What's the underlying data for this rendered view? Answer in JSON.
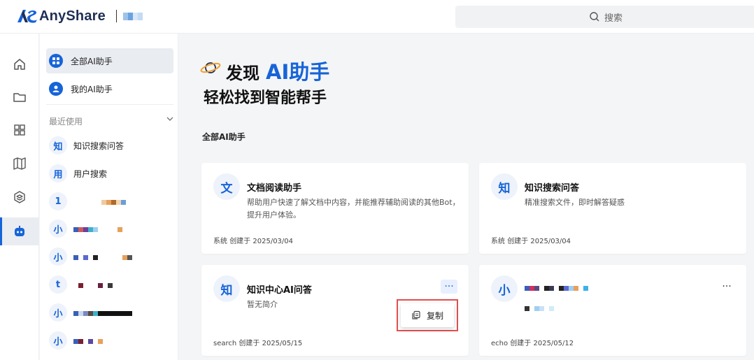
{
  "app": {
    "logo_text": "AnyShare"
  },
  "search": {
    "placeholder": "搜索"
  },
  "sidebar": {
    "nav": [
      {
        "label": "全部AI助手",
        "icon": "grid-icon",
        "active": true
      },
      {
        "label": "我的AI助手",
        "icon": "user-icon",
        "active": false
      }
    ],
    "recent_title": "最近使用",
    "recent": [
      {
        "avatar": "知",
        "label": "知识搜索问答"
      },
      {
        "avatar": "用",
        "label": "用户搜索"
      },
      {
        "avatar": "1",
        "label": ""
      },
      {
        "avatar": "小",
        "label": ""
      },
      {
        "avatar": "小",
        "label": ""
      },
      {
        "avatar": "t",
        "label": ""
      },
      {
        "avatar": "小",
        "label": ""
      },
      {
        "avatar": "小",
        "label": ""
      }
    ]
  },
  "rail": [
    "home-icon",
    "folder-icon",
    "apps-icon",
    "map-icon",
    "layers-icon",
    "bot-icon"
  ],
  "hero": {
    "title": "发现",
    "title_accent": "AI助手",
    "subtitle": "轻松找到智能帮手"
  },
  "section_title": "全部AI助手",
  "cards": [
    {
      "avatar": "文",
      "name": "文档阅读助手",
      "desc": "帮助用户快速了解文档中内容，并能推荐辅助阅读的其他Bot，提升用户体验。",
      "creator": "系统",
      "created_label": "创建于",
      "date": "2025/03/04"
    },
    {
      "avatar": "知",
      "name": "知识搜索问答",
      "desc": "精准搜索文件，即时解答疑惑",
      "creator": "系统",
      "created_label": "创建于",
      "date": "2025/03/04"
    },
    {
      "avatar": "知",
      "name": "知识中心AI问答",
      "desc": "暂无简介",
      "creator": "search",
      "created_label": "创建于",
      "date": "2025/05/15"
    },
    {
      "avatar": "小",
      "name": "",
      "desc": "",
      "creator": "echo",
      "created_label": "创建于",
      "date": "2025/05/12"
    }
  ],
  "menu": {
    "copy_label": "复制"
  },
  "colors": {
    "accent": "#1664d8",
    "highlight_border": "#e05050"
  }
}
